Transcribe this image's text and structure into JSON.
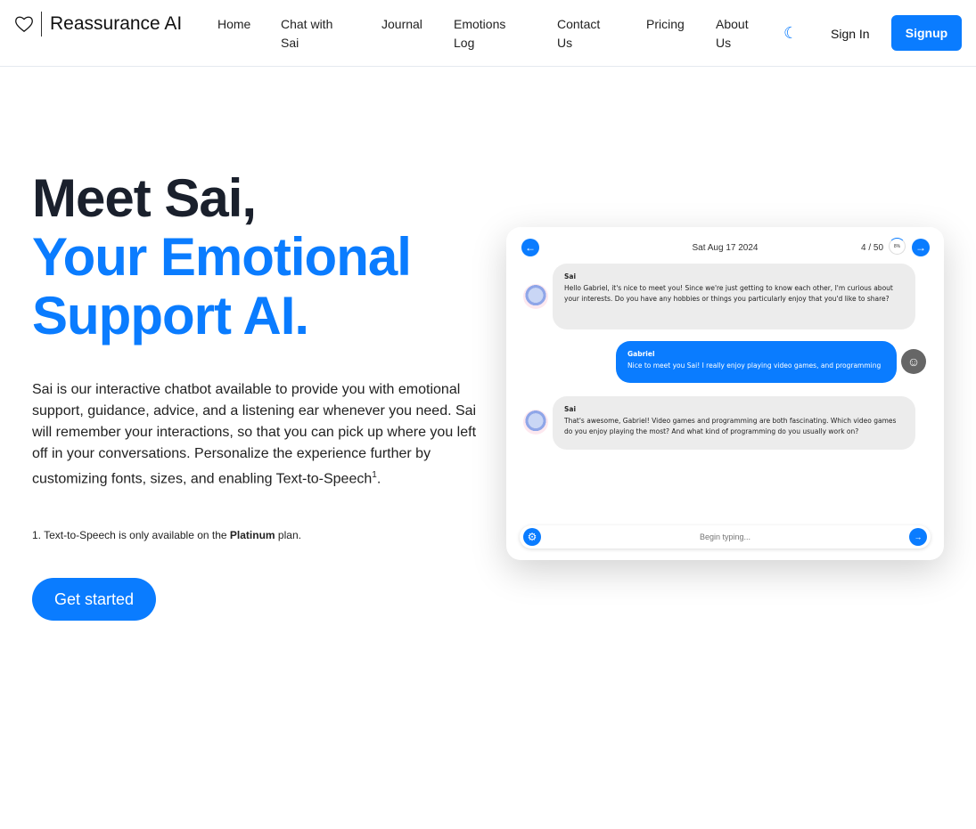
{
  "nav": {
    "brand": "Reassurance AI",
    "links": [
      "Home",
      "Chat with Sai",
      "Journal",
      "Emotions Log",
      "Contact Us",
      "Pricing",
      "About Us"
    ],
    "sign_in": "Sign In",
    "signup": "Signup"
  },
  "hero": {
    "title_line1": "Meet Sai,",
    "title_line2": "Your Emotional",
    "title_line3": "Support AI.",
    "description": "Sai is our interactive chatbot available to provide you with emotional support, guidance, advice, and a listening ear whenever you need. Sai will remember your interactions, so that you can pick up where you left off in your conversations. Personalize the experience further by customizing fonts, sizes, and enabling Text-to-Speech",
    "description_sup": "1",
    "description_end": ".",
    "footnote_prefix": "1. Text-to-Speech is only available on the ",
    "footnote_bold": "Platinum",
    "footnote_suffix": " plan.",
    "cta": "Get started"
  },
  "chat": {
    "date": "Sat Aug 17 2024",
    "count": "4 / 50",
    "progress_label": "8%",
    "progress_percent": 8,
    "messages": [
      {
        "sender": "Sai",
        "text": "Hello Gabriel, it's nice to meet you! Since we're just getting to know each other, I'm curious about your interests. Do you have any hobbies or things you particularly enjoy that you'd like to share?"
      },
      {
        "sender": "Gabriel",
        "text": "Nice to meet you Sai! I really enjoy playing video games, and programming"
      },
      {
        "sender": "Sai",
        "text": "That's awesome, Gabriel! Video games and programming are both fascinating. Which video games do you enjoy playing the most? And what kind of programming do you usually work on?"
      }
    ],
    "placeholder": "Begin typing..."
  },
  "colors": {
    "accent": "#0a7cff"
  }
}
